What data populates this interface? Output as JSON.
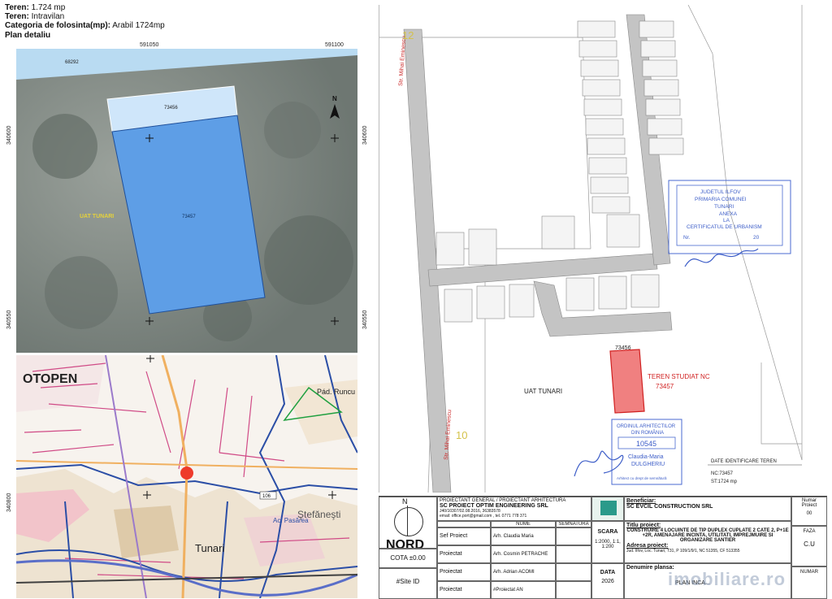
{
  "header": {
    "line1_label": "Teren:",
    "line1_value": "1.724 mp",
    "line2_label": "Teren:",
    "line2_value": "Intravilan",
    "line3_label": "Categoria de folosinta(mp):",
    "line3_value": "Arabil 1724mp",
    "line4": "Plan detaliu"
  },
  "ortho": {
    "coord_top_left": "591050",
    "coord_top_right": "591100",
    "coord_left_top": "340600",
    "coord_left_bottom": "340550",
    "coord_right_top": "340600",
    "coord_right_bottom": "340550",
    "parcel_top_label": "68292",
    "parcel_small_label": "73456",
    "parcel_big_label": "73457",
    "uat_label": "UAT TUNARI",
    "north_letter": "N"
  },
  "topo": {
    "label_otopeni": "OTOPEN",
    "label_pad_runcu": "Pád. Runcu",
    "label_stefanesti": "Ştefăneşti",
    "label_ac_pasarea": "Ac. Pasărea",
    "label_tunari": "Tunari",
    "coord_left": "340800",
    "road_1": "106"
  },
  "plan": {
    "street_label_1": "Str. Mihai Eminescu",
    "street_label_2": "Str. Mihai Eminescu",
    "num_12": "12",
    "num_10": "10",
    "parcel_label": "73456",
    "teren_label": "TEREN STUDIAT NC",
    "teren_nc": "73457",
    "uat_label": "UAT TUNARI",
    "stamp_top_line1": "JUDETUL ILFOV",
    "stamp_top_line2": "PRIMARIA COMUNEI",
    "stamp_top_line3": "TUNARI",
    "stamp_top_line4": "ANEXA",
    "stamp_top_line5": "LA",
    "stamp_top_line6": "CERTIFICATUL DE URBANISM",
    "stamp_top_line7": "Nr.",
    "stamp_top_line8": "20",
    "stamp_arch_line1": "ORDINUL ARHITECTILOR",
    "stamp_arch_line2": "DIN ROMÂNIA",
    "stamp_arch_line3": "10545",
    "stamp_arch_line4": "Claudia-Maria",
    "stamp_arch_line5": "DULGHERIU",
    "stamp_arch_line6": "Arhitect cu drept de semnătură",
    "id_title": "DATE IDENTIFICARE TEREN",
    "id_line1": "NC:73457",
    "id_line2": "ST:1724 mp"
  },
  "titleblock": {
    "north_letter": "N",
    "nord": "NORD",
    "cota": "COTA ±0.00",
    "site_id": "#Site ID",
    "proiectant_title": "PROIECTANT GENERAL / PROIECTANT ARHITECTURA",
    "proiectant_name": "SC PROIECT OPTIM ENGINEERING SRL",
    "proiectant_info1": "J40/10307/02.08.2016, 36383578",
    "proiectant_info2": "email: office.port@gmail.com , tel. 0771 778 371",
    "col_nume": "NUME",
    "col_semnatura": "SEMNATURA",
    "row1_role": "Sef Proiect",
    "row1_name": "Arh. Claudia Maria DULGHERIU",
    "row2_role": "Proiectat",
    "row2_name": "Arh. Cosmin PETRACHE",
    "row3_role": "Proiectat",
    "row3_name": "Arh. Adrian ACOMI",
    "row4_role": "Proiectat",
    "row4_name": "#Proiectat AN",
    "scara_label": "SCARA",
    "scara_value": "1:2000, 1:1, 1:200",
    "data_label": "DATA",
    "data_value": "2026",
    "beneficiar_label": "Beneficiar:",
    "beneficiar_value": "SC EVCIL CONSTRUCTION SRL",
    "titlu_label": "Titlu proiect:",
    "titlu_value": "CONSTRUIRE 4 LOCUINTE DE TIP DUPLEX CUPLATE 2 CATE 2, P+1E +2R, AMENAJARE INCINTA, UTILITATI, IMPREJMUIRE SI ORGANIZARE SANTIER",
    "adresa_label": "Adresa proiect:",
    "adresa_value": "Jud. Ilfov, Loc. Tunari, T31, P 109/1/9/1, NC 51355, CF 513355",
    "denumire_label": "Denumire plansa:",
    "denumire_value": "PLAN INCA...",
    "numar_proiect_label": "Numar Proiect",
    "numar_proiect_value": "00",
    "faza_label": "FAZA",
    "faza_value": "C.U",
    "numar_label": "NUMAR"
  },
  "watermark": "imobiliare.ro"
}
